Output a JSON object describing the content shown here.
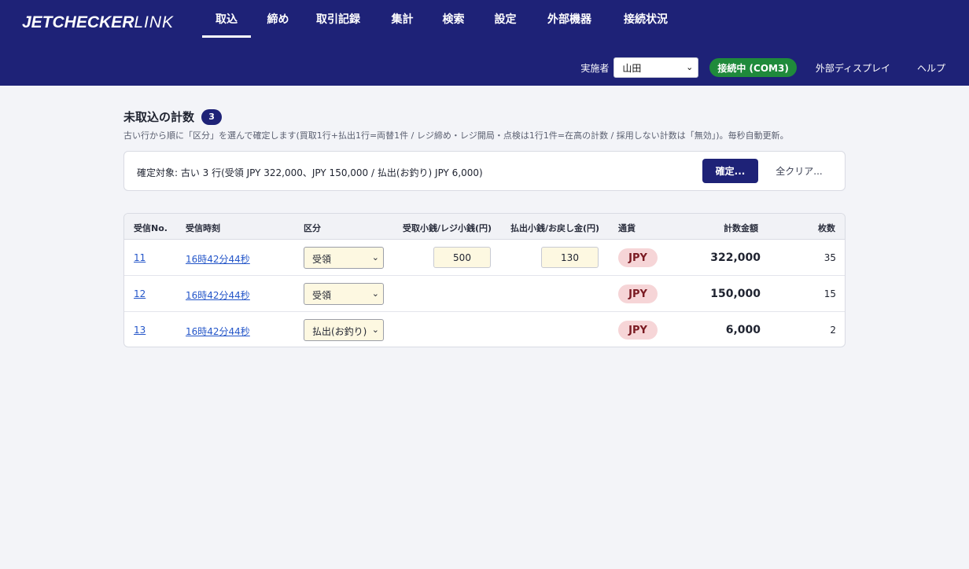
{
  "app": {
    "logo_bold": "JETCHECKER",
    "logo_thin": "LINK",
    "nav_tabs": [
      {
        "label": "取込",
        "active": true
      },
      {
        "label": "締め",
        "active": false
      },
      {
        "label": "取引記録",
        "active": false
      },
      {
        "label": "集計",
        "active": false
      },
      {
        "label": "検索",
        "active": false
      },
      {
        "label": "設定",
        "active": false
      },
      {
        "label": "外部機器",
        "active": false
      },
      {
        "label": "接続状況",
        "active": false
      }
    ],
    "operator_label": "実施者",
    "operator_value": "山田",
    "status": "接続中 (COM3)",
    "external_display": "外部ディスプレイ",
    "help": "ヘルプ"
  },
  "main": {
    "title": "未取込の計数",
    "count": "3",
    "description": "古い行から順に「区分」を選んで確定します(買取1行+払出1行=両替1件 / レジ締め・レジ開局・点検は1行1件=在高の計数 / 採用しない計数は「無効」)。毎秒自動更新。",
    "confirm_text": "確定対象: 古い 3 行(受領 JPY 322,000、JPY 150,000 / 払出(お釣り) JPY 6,000)",
    "confirm_button": "確定...",
    "clear_button": "全クリア..."
  },
  "table": {
    "headers": {
      "no": "受信No.",
      "time": "受信時刻",
      "kubun": "区分",
      "receive": "受取小銭/レジ小銭(円)",
      "payout": "払出小銭/お戻し金(円)",
      "currency": "通貨",
      "amount": "計数金額",
      "pieces": "枚数"
    },
    "rows": [
      {
        "no": "11",
        "time": "16時42分44秒",
        "kubun": "受領",
        "receive": "500",
        "payout": "130",
        "currency": "JPY",
        "amount": "322,000",
        "pieces": "35"
      },
      {
        "no": "12",
        "time": "16時42分44秒",
        "kubun": "受領",
        "receive": "",
        "payout": "",
        "currency": "JPY",
        "amount": "150,000",
        "pieces": "15"
      },
      {
        "no": "13",
        "time": "16時42分44秒",
        "kubun": "払出(お釣り)",
        "receive": "",
        "payout": "",
        "currency": "JPY",
        "amount": "6,000",
        "pieces": "2"
      }
    ]
  },
  "colors": {
    "header_bg": "#1e2277",
    "status_green": "#1f8a3b",
    "currency_pill": "#f6d5d7",
    "input_bg": "#fdf8e1",
    "link": "#2456c9"
  },
  "icons": {
    "select_caret": "chevron-down-icon"
  }
}
